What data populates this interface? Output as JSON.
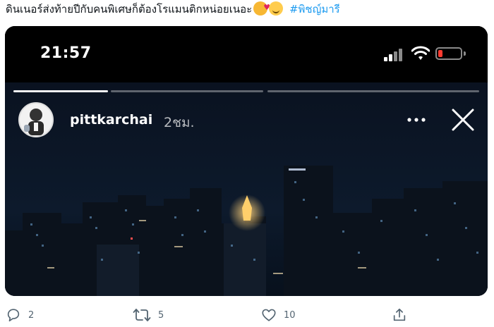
{
  "tweet": {
    "text": "ดินเนอร์ส่งท้ายปีกับคนพิเศษก็ต้องโรแมนติกหน่อยเนอะ",
    "hashtag": "#พิชญ์มารี",
    "emojis": [
      "smiling-face-with-hearts-emoji",
      "smiling-face-emoji"
    ]
  },
  "story": {
    "status_bar": {
      "clock": "21:57",
      "battery_state": "low",
      "battery_color": "#ff3b30"
    },
    "progress_segments": [
      1,
      0,
      0
    ],
    "username": "pittkarchai",
    "time_ago": "2ชม.",
    "icons": {
      "more": "more-dots-icon",
      "close": "close-icon"
    }
  },
  "actions": {
    "reply_count": "2",
    "retweet_count": "5",
    "like_count": "10"
  },
  "colors": {
    "link": "#1d9bf0",
    "action_gray": "#536471"
  }
}
